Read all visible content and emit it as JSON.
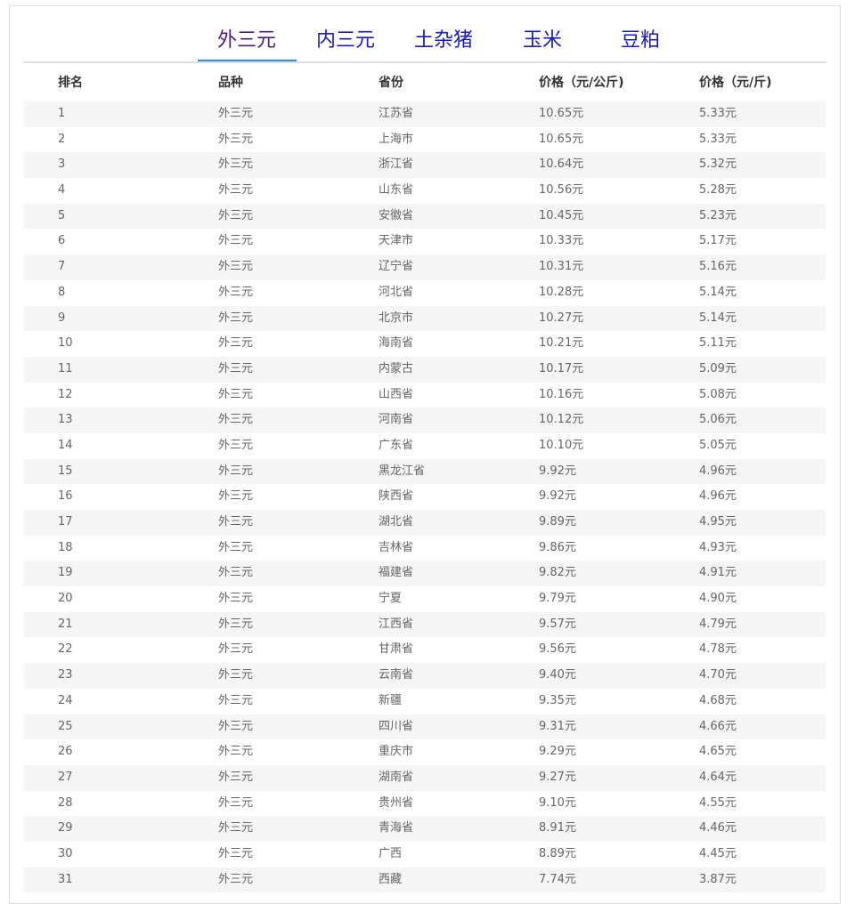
{
  "tabs": [
    {
      "label": "外三元",
      "active": true
    },
    {
      "label": "内三元",
      "active": false
    },
    {
      "label": "土杂猪",
      "active": false
    },
    {
      "label": "玉米",
      "active": false
    },
    {
      "label": "豆粕",
      "active": false
    }
  ],
  "colors": {
    "tab_text": "#1a1ac0",
    "tab_active_text": "#4b1d7a",
    "tab_underline": "#2a8ee8"
  },
  "table": {
    "headers": [
      "排名",
      "品种",
      "省份",
      "价格（元/公斤)",
      "价格（元/斤)"
    ],
    "rows": [
      [
        "1",
        "外三元",
        "江苏省",
        "10.65元",
        "5.33元"
      ],
      [
        "2",
        "外三元",
        "上海市",
        "10.65元",
        "5.33元"
      ],
      [
        "3",
        "外三元",
        "浙江省",
        "10.64元",
        "5.32元"
      ],
      [
        "4",
        "外三元",
        "山东省",
        "10.56元",
        "5.28元"
      ],
      [
        "5",
        "外三元",
        "安徽省",
        "10.45元",
        "5.23元"
      ],
      [
        "6",
        "外三元",
        "天津市",
        "10.33元",
        "5.17元"
      ],
      [
        "7",
        "外三元",
        "辽宁省",
        "10.31元",
        "5.16元"
      ],
      [
        "8",
        "外三元",
        "河北省",
        "10.28元",
        "5.14元"
      ],
      [
        "9",
        "外三元",
        "北京市",
        "10.27元",
        "5.14元"
      ],
      [
        "10",
        "外三元",
        "海南省",
        "10.21元",
        "5.11元"
      ],
      [
        "11",
        "外三元",
        "内蒙古",
        "10.17元",
        "5.09元"
      ],
      [
        "12",
        "外三元",
        "山西省",
        "10.16元",
        "5.08元"
      ],
      [
        "13",
        "外三元",
        "河南省",
        "10.12元",
        "5.06元"
      ],
      [
        "14",
        "外三元",
        "广东省",
        "10.10元",
        "5.05元"
      ],
      [
        "15",
        "外三元",
        "黑龙江省",
        "9.92元",
        "4.96元"
      ],
      [
        "16",
        "外三元",
        "陕西省",
        "9.92元",
        "4.96元"
      ],
      [
        "17",
        "外三元",
        "湖北省",
        "9.89元",
        "4.95元"
      ],
      [
        "18",
        "外三元",
        "吉林省",
        "9.86元",
        "4.93元"
      ],
      [
        "19",
        "外三元",
        "福建省",
        "9.82元",
        "4.91元"
      ],
      [
        "20",
        "外三元",
        "宁夏",
        "9.79元",
        "4.90元"
      ],
      [
        "21",
        "外三元",
        "江西省",
        "9.57元",
        "4.79元"
      ],
      [
        "22",
        "外三元",
        "甘肃省",
        "9.56元",
        "4.78元"
      ],
      [
        "23",
        "外三元",
        "云南省",
        "9.40元",
        "4.70元"
      ],
      [
        "24",
        "外三元",
        "新疆",
        "9.35元",
        "4.68元"
      ],
      [
        "25",
        "外三元",
        "四川省",
        "9.31元",
        "4.66元"
      ],
      [
        "26",
        "外三元",
        "重庆市",
        "9.29元",
        "4.65元"
      ],
      [
        "27",
        "外三元",
        "湖南省",
        "9.27元",
        "4.64元"
      ],
      [
        "28",
        "外三元",
        "贵州省",
        "9.10元",
        "4.55元"
      ],
      [
        "29",
        "外三元",
        "青海省",
        "8.91元",
        "4.46元"
      ],
      [
        "30",
        "外三元",
        "广西",
        "8.89元",
        "4.45元"
      ],
      [
        "31",
        "外三元",
        "西藏",
        "7.74元",
        "3.87元"
      ]
    ]
  }
}
